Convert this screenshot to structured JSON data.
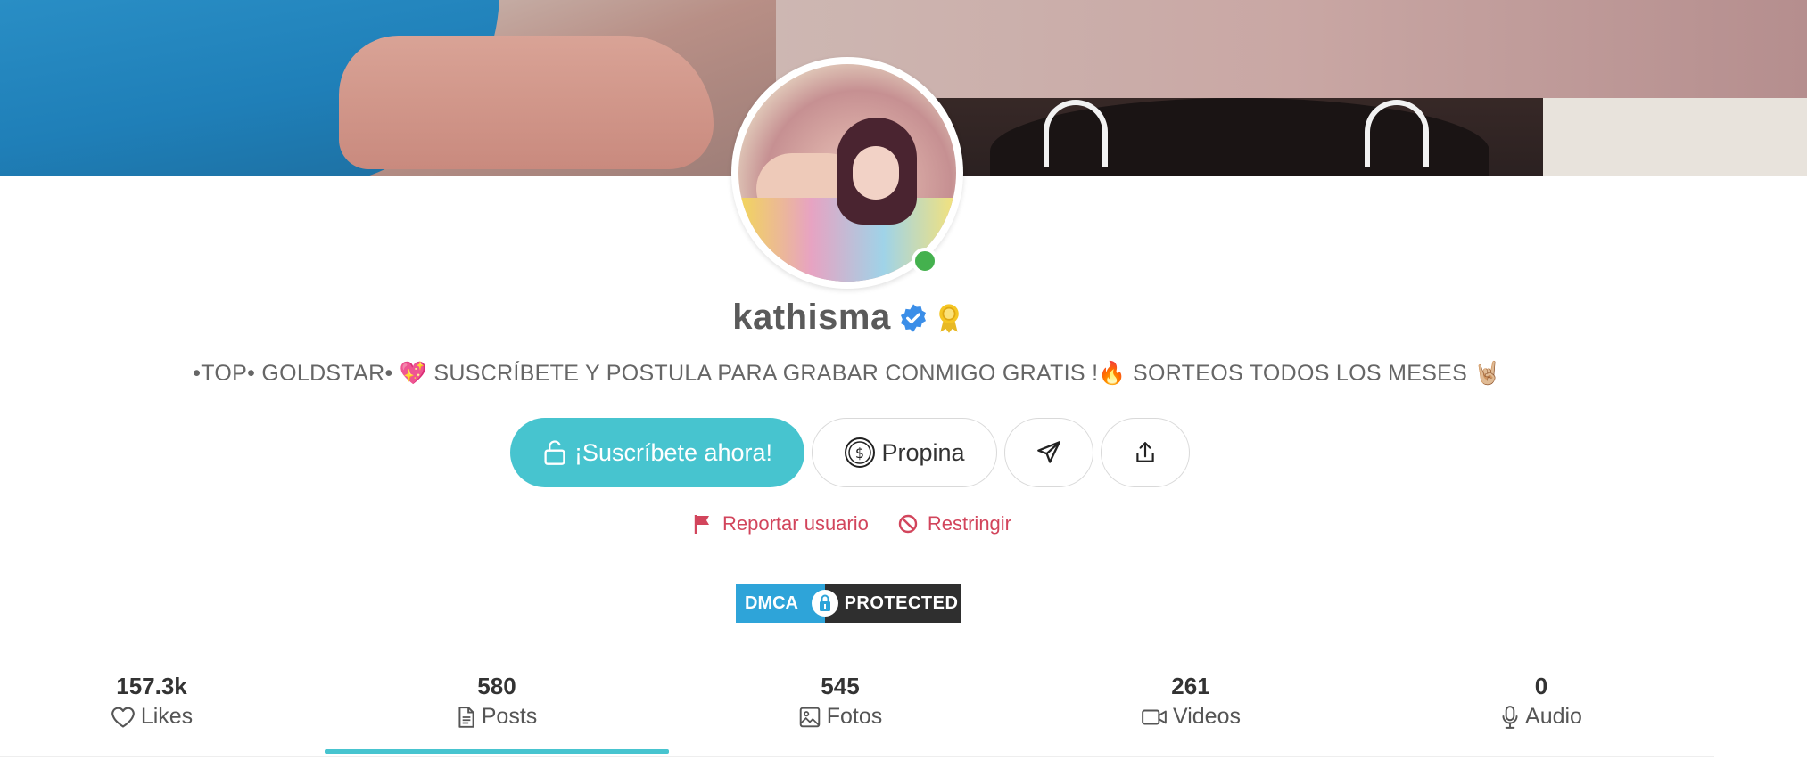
{
  "profile": {
    "username": "kathisma",
    "bio": "•TOP• GOLDSTAR• 💖 SUSCRÍBETE Y POSTULA PARA GRABAR CONMIGO GRATIS !🔥 SORTEOS TODOS LOS MESES 🤘🏼",
    "status": "online"
  },
  "actions": {
    "subscribe_label": "¡Suscríbete ahora!",
    "tip_label": "Propina",
    "message_icon": "paper-plane-icon",
    "share_icon": "share-icon"
  },
  "moderation": {
    "report_label": "Reportar usuario",
    "restrict_label": "Restringir"
  },
  "badge": {
    "dmca_left": "DMCA",
    "dmca_right": "PROTECTED"
  },
  "stats": [
    {
      "value": "157.3k",
      "label": "Likes",
      "icon": "heart-icon"
    },
    {
      "value": "580",
      "label": "Posts",
      "icon": "document-icon"
    },
    {
      "value": "545",
      "label": "Fotos",
      "icon": "image-icon"
    },
    {
      "value": "261",
      "label": "Videos",
      "icon": "video-icon"
    },
    {
      "value": "0",
      "label": "Audio",
      "icon": "microphone-icon"
    }
  ],
  "active_tab": "Posts",
  "colors": {
    "accent": "#47c4cf",
    "danger": "#d2455c",
    "online": "#44b14e",
    "verified": "#3b8ee8"
  }
}
